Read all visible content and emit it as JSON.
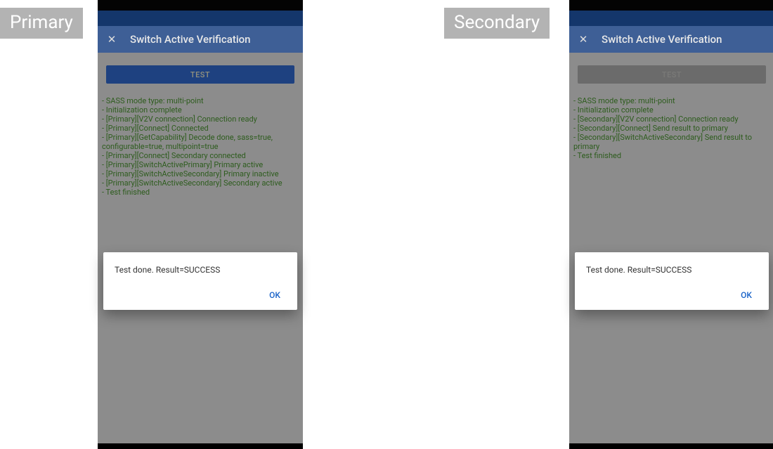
{
  "tags": {
    "primary": "Primary",
    "secondary": "Secondary"
  },
  "primary": {
    "title": "Switch Active Verification",
    "test_btn": "TEST",
    "log": [
      "- SASS mode type: multi-point",
      "- Initialization complete",
      "- [Primary][V2V connection] Connection ready",
      "- [Primary][Connect] Connected",
      "- [Primary][GetCapability] Decode done, sass=true, configurable=true, multipoint=true",
      "- [Primary][Connect] Secondary connected",
      "- [Primary][SwitchActivePrimary] Primary active",
      "- [Primary][SwitchActiveSecondary] Primary inactive",
      "- [Primary][SwitchActiveSecondary] Secondary active",
      "- Test finished"
    ],
    "dialog": {
      "message": "Test done. Result=SUCCESS",
      "ok": "OK"
    }
  },
  "secondary": {
    "title": "Switch Active Verification",
    "test_btn": "TEST",
    "log": [
      "- SASS mode type: multi-point",
      "- Initialization complete",
      "- [Secondary][V2V connection] Connection ready",
      "- [Secondary][Connect] Send result to primary",
      "- [Secondary][SwitchActiveSecondary] Send result to primary",
      "- Test finished"
    ],
    "dialog": {
      "message": "Test done. Result=SUCCESS",
      "ok": "OK"
    }
  }
}
